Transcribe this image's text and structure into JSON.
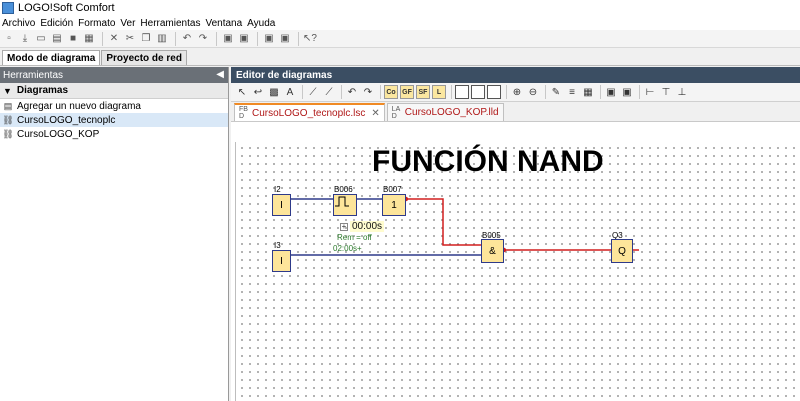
{
  "window": {
    "title": "LOGO!Soft Comfort"
  },
  "menu": [
    "Archivo",
    "Edición",
    "Formato",
    "Ver",
    "Herramientas",
    "Ventana",
    "Ayuda"
  ],
  "mode_tabs": {
    "diagram": "Modo de diagrama",
    "network": "Proyecto de red"
  },
  "left": {
    "header": "Herramientas",
    "section": "Diagramas",
    "items": [
      {
        "label": "Agregar un nuevo diagrama",
        "icon": "new-diagram-icon"
      },
      {
        "label": "CursoLOGO_tecnoplc",
        "icon": "fbd-diagram-icon"
      },
      {
        "label": "CursoLOGO_KOP",
        "icon": "ladder-diagram-icon"
      }
    ]
  },
  "editor": {
    "header": "Editor de diagramas",
    "tools": {
      "co": "Co",
      "gf": "GF",
      "sf": "SF",
      "l": "L"
    },
    "tabs": [
      {
        "label": "CursoLOGO_tecnoplc.lsc",
        "close": "✕"
      },
      {
        "label": "CursoLOGO_KOP.lld"
      }
    ]
  },
  "diagram": {
    "title": "FUNCIÓN NAND",
    "blocks": {
      "i2": {
        "label": "I2",
        "text": "I"
      },
      "b006": {
        "label": "B006"
      },
      "b007": {
        "label": "B007",
        "text": "1"
      },
      "i3": {
        "label": "I3",
        "text": "I"
      },
      "b005": {
        "label": "B005",
        "text": "&"
      },
      "q3": {
        "label": "Q3",
        "text": "Q"
      }
    },
    "b006_params": {
      "time": "00:00s",
      "expand": "+",
      "rem": "Rem = off",
      "t": "02:00s+"
    }
  },
  "colors": {
    "wire_red": "#d21f1f",
    "wire_blue": "#2e3a8a",
    "block_fill": "#fde59a",
    "tab_accent": "#f08a24"
  }
}
